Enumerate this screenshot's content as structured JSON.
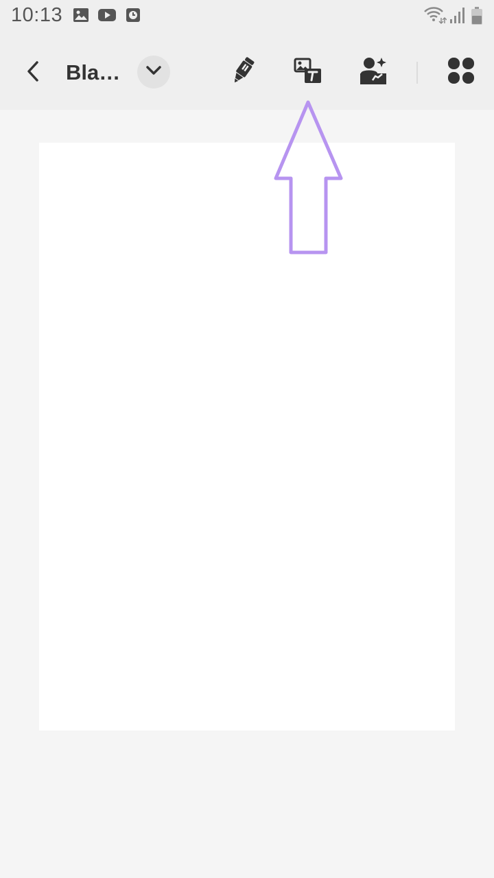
{
  "status_bar": {
    "time": "10:13",
    "notification_icons": [
      "gallery-icon",
      "youtube-icon",
      "clock-app-icon"
    ],
    "system_icons": [
      "wifi-icon",
      "signal-icon",
      "battery-icon"
    ]
  },
  "toolbar": {
    "back_icon": "chevron-left-icon",
    "title": "Bla…",
    "dropdown_icon": "chevron-down-icon",
    "tools": [
      "highlighter-icon",
      "image-text-icon",
      "ai-sticker-icon",
      "more-apps-icon"
    ]
  },
  "overlay": {
    "hint_arrow_color": "#b794f0"
  },
  "colors": {
    "toolbar_bg": "#efefef",
    "canvas_bg": "#f5f5f5",
    "page_bg": "#ffffff",
    "icon": "#333333"
  }
}
